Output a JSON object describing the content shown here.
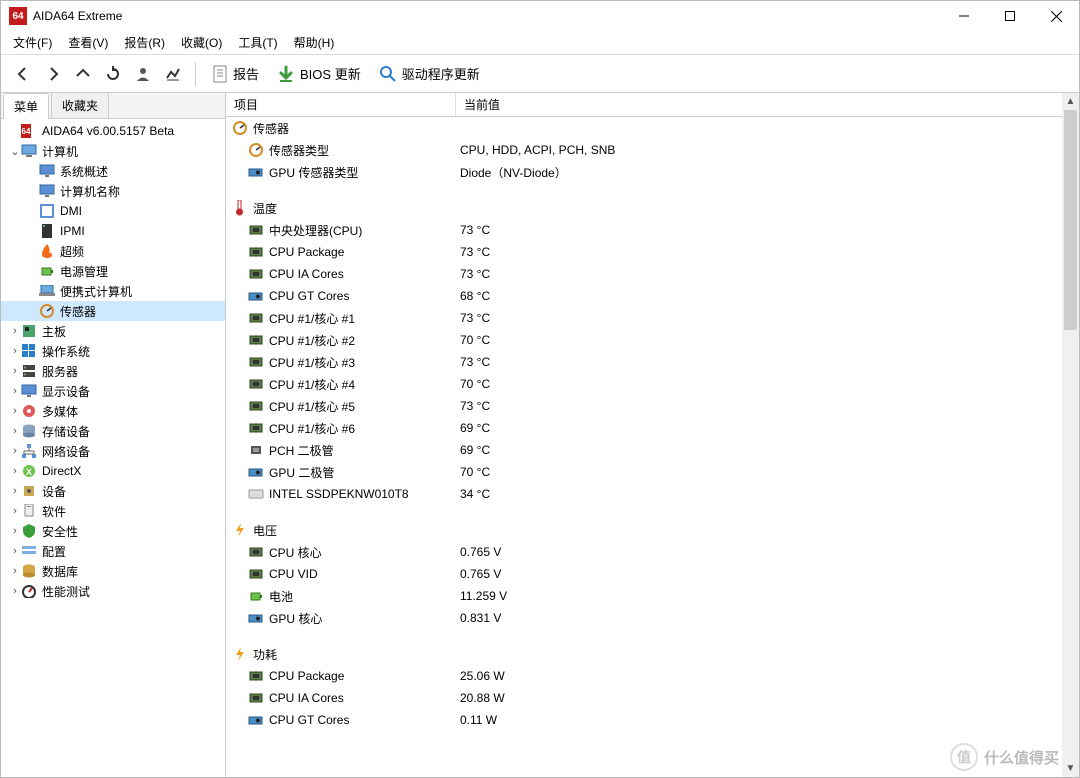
{
  "window": {
    "title": "AIDA64 Extreme",
    "app_icon_text": "64"
  },
  "menu": {
    "file": "文件(F)",
    "view": "查看(V)",
    "report": "报告(R)",
    "favorite": "收藏(O)",
    "tools": "工具(T)",
    "help": "帮助(H)"
  },
  "toolbar": {
    "report": "报告",
    "bios_update": "BIOS 更新",
    "driver_update": "驱动程序更新"
  },
  "tabs": {
    "menu": "菜单",
    "favorites": "收藏夹"
  },
  "tree": {
    "root": "AIDA64 v6.00.5157 Beta",
    "computer": "计算机",
    "system_overview": "系统概述",
    "computer_name": "计算机名称",
    "dmi": "DMI",
    "ipmi": "IPMI",
    "overclock": "超频",
    "power_mgmt": "电源管理",
    "portable": "便携式计算机",
    "sensor": "传感器",
    "motherboard": "主板",
    "os": "操作系统",
    "server": "服务器",
    "display": "显示设备",
    "multimedia": "多媒体",
    "storage": "存储设备",
    "network": "网络设备",
    "directx": "DirectX",
    "devices": "设备",
    "software": "软件",
    "security": "安全性",
    "config": "配置",
    "database": "数据库",
    "benchmark": "性能测试"
  },
  "columns": {
    "item": "项目",
    "value": "当前值"
  },
  "content": {
    "sensor_hdr": "传感器",
    "sensor_type_lbl": "传感器类型",
    "sensor_type_val": "CPU, HDD, ACPI, PCH, SNB",
    "gpu_sensor_lbl": "GPU 传感器类型",
    "gpu_sensor_val": "Diode（NV-Diode）",
    "temp_hdr": "温度",
    "temps": [
      {
        "label": "中央处理器(CPU)",
        "value": "73 °C",
        "icon": "chip"
      },
      {
        "label": "CPU Package",
        "value": "73 °C",
        "icon": "chip"
      },
      {
        "label": "CPU IA Cores",
        "value": "73 °C",
        "icon": "chip"
      },
      {
        "label": "CPU GT Cores",
        "value": "68 °C",
        "icon": "gpu"
      },
      {
        "label": "CPU #1/核心 #1",
        "value": "73 °C",
        "icon": "chip"
      },
      {
        "label": "CPU #1/核心 #2",
        "value": "70 °C",
        "icon": "chip"
      },
      {
        "label": "CPU #1/核心 #3",
        "value": "73 °C",
        "icon": "chip"
      },
      {
        "label": "CPU #1/核心 #4",
        "value": "70 °C",
        "icon": "chip"
      },
      {
        "label": "CPU #1/核心 #5",
        "value": "73 °C",
        "icon": "chip"
      },
      {
        "label": "CPU #1/核心 #6",
        "value": "69 °C",
        "icon": "chip"
      },
      {
        "label": "PCH 二极管",
        "value": "69 °C",
        "icon": "pch"
      },
      {
        "label": "GPU 二极管",
        "value": "70 °C",
        "icon": "gpu"
      },
      {
        "label": "INTEL SSDPEKNW010T8",
        "value": "34 °C",
        "icon": "ssd"
      }
    ],
    "volt_hdr": "电压",
    "volts": [
      {
        "label": "CPU 核心",
        "value": "0.765 V",
        "icon": "chip"
      },
      {
        "label": "CPU VID",
        "value": "0.765 V",
        "icon": "chip"
      },
      {
        "label": "电池",
        "value": "11.259 V",
        "icon": "battery"
      },
      {
        "label": "GPU 核心",
        "value": "0.831 V",
        "icon": "gpu"
      }
    ],
    "power_hdr": "功耗",
    "powers": [
      {
        "label": "CPU Package",
        "value": "25.06 W",
        "icon": "chip"
      },
      {
        "label": "CPU IA Cores",
        "value": "20.88 W",
        "icon": "chip"
      },
      {
        "label": "CPU GT Cores",
        "value": "0.11 W",
        "icon": "gpu"
      }
    ]
  },
  "watermark": "什么值得买"
}
